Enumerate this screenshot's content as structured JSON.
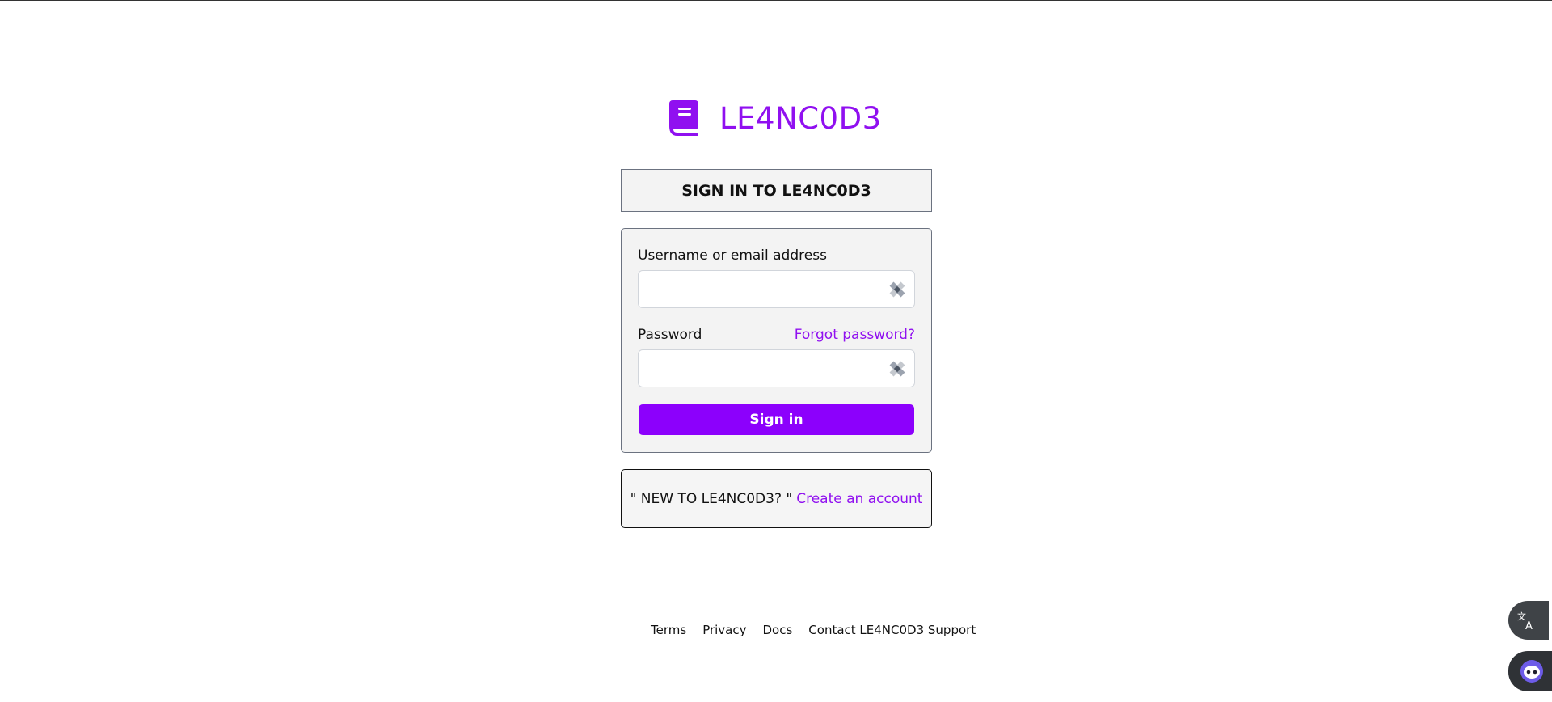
{
  "brand": {
    "name": "LE4NC0D3",
    "accent_color": "#9010f0",
    "icon": "book-icon"
  },
  "signin_title": "SIGN IN TO LE4NC0D3",
  "form": {
    "username_label": "Username or email address",
    "username_value": "",
    "password_label": "Password",
    "password_value": "",
    "forgot_label": "Forgot password?",
    "submit_label": "Sign in",
    "autofill_icon": "autofill-icon"
  },
  "signup": {
    "prompt": "\" NEW TO LE4NC0D3? \"",
    "link_label": "Create an account"
  },
  "footer": {
    "links": [
      "Terms",
      "Privacy",
      "Docs",
      "Contact LE4NC0D3 Support"
    ]
  },
  "floating": {
    "translate_icon": "translate-icon",
    "assistant_icon": "assistant-bot-icon"
  }
}
